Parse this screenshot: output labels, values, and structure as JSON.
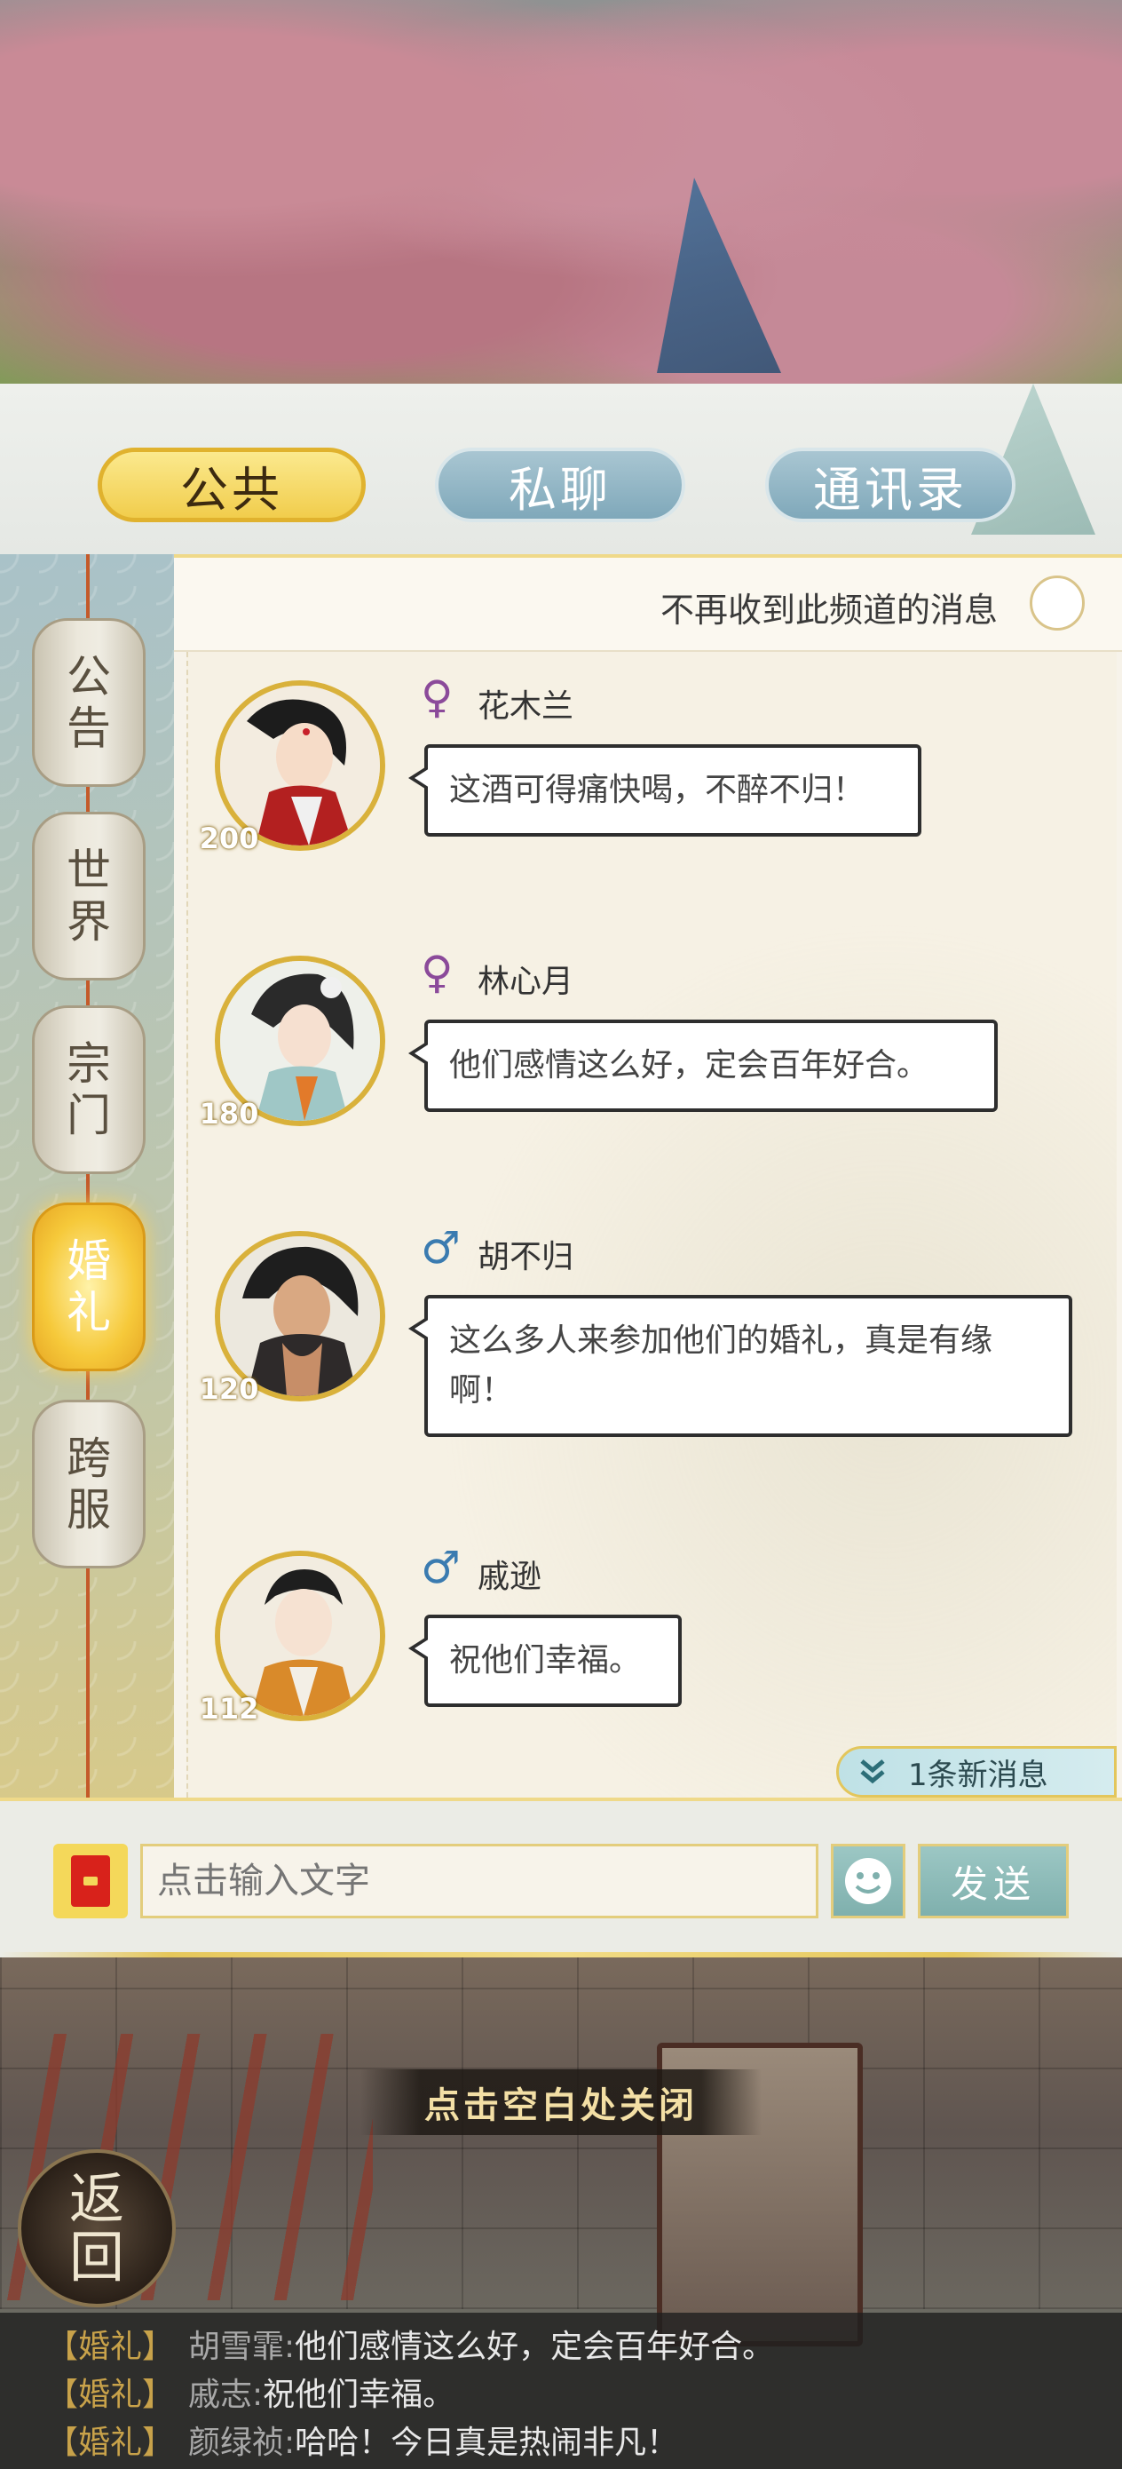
{
  "tabs": {
    "public": "公共",
    "private": "私聊",
    "contacts": "通讯录"
  },
  "channels": [
    {
      "label": [
        "公",
        "告"
      ],
      "active": false
    },
    {
      "label": [
        "世",
        "界"
      ],
      "active": false
    },
    {
      "label": [
        "宗",
        "门"
      ],
      "active": false
    },
    {
      "label": [
        "婚",
        "礼"
      ],
      "active": true
    },
    {
      "label": [
        "跨",
        "服"
      ],
      "active": false
    }
  ],
  "mute": {
    "label": "不再收到此频道的消息",
    "enabled": false
  },
  "messages": [
    {
      "name": "花木兰",
      "gender": "female",
      "gender_icon": "♀",
      "level": "200",
      "text": "这酒可得痛快喝，不醉不归！"
    },
    {
      "name": "林心月",
      "gender": "female",
      "gender_icon": "♀",
      "level": "180",
      "text": "他们感情这么好，定会百年好合。"
    },
    {
      "name": "胡不归",
      "gender": "male",
      "gender_icon": "♂",
      "level": "120",
      "text": "这么多人来参加他们的婚礼，真是有缘啊！"
    },
    {
      "name": "戚逊",
      "gender": "male",
      "gender_icon": "♂",
      "level": "112",
      "text": "祝他们幸福。"
    }
  ],
  "new_messages": {
    "icon": "double-chevron-down-icon",
    "label": "1条新消息"
  },
  "input": {
    "placeholder": "点击输入文字",
    "send_label": "发送",
    "emoji_icon": "smiley-icon",
    "redpacket_icon": "red-envelope-icon"
  },
  "close_hint": "点击空白处关闭",
  "return_button": [
    "返",
    "回"
  ],
  "ticker": [
    {
      "tag": "【婚礼】",
      "name": "胡雪霏:",
      "text": "他们感情这么好，定会百年好合。"
    },
    {
      "tag": "【婚礼】",
      "name": "戚志:",
      "text": "祝他们幸福。"
    },
    {
      "tag": "【婚礼】",
      "name": "颜绿祯:",
      "text": "哈哈！今日真是热闹非凡！"
    }
  ],
  "colors": {
    "active_tab": "#f1cd4c",
    "inactive_tab": "#7fa8ba",
    "accent_gold": "#e3c65c",
    "female": "#8b4a9a",
    "male": "#3a7bb0"
  }
}
